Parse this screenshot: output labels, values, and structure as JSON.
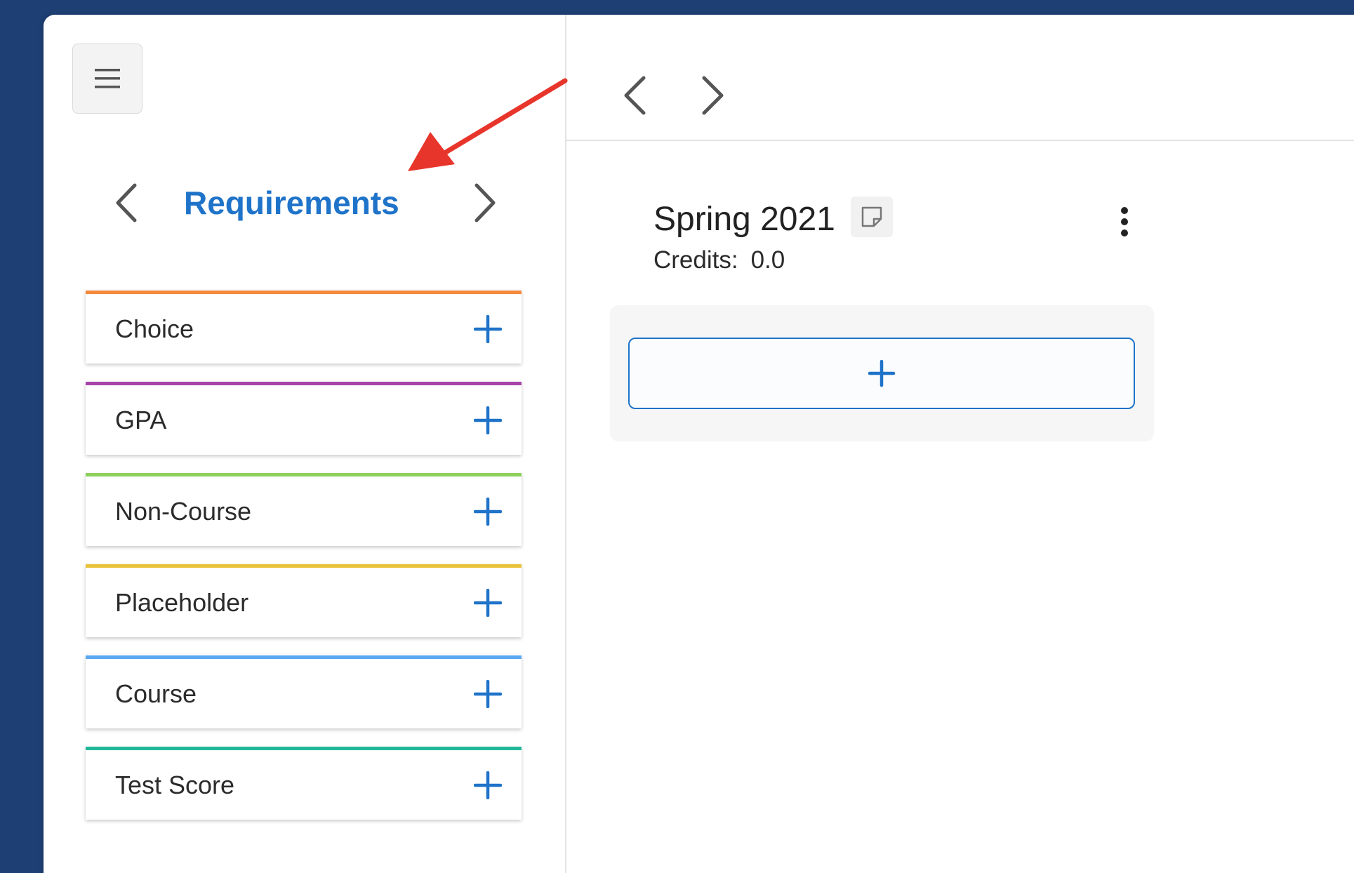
{
  "sidebar": {
    "menu_icon": "hamburger-icon",
    "title": "Requirements",
    "prev_icon": "chevron-left-icon",
    "next_icon": "chevron-right-icon",
    "requirements": [
      {
        "label": "Choice",
        "color": "#f58a3c"
      },
      {
        "label": "GPA",
        "color": "#a745a8"
      },
      {
        "label": "Non-Course",
        "color": "#8ccf5a"
      },
      {
        "label": "Placeholder",
        "color": "#e8c33a"
      },
      {
        "label": "Course",
        "color": "#5aa9f2"
      },
      {
        "label": "Test Score",
        "color": "#1fb898"
      }
    ],
    "add_icon": "plus-icon"
  },
  "term": {
    "title": "Spring 2021",
    "credits_label": "Credits:",
    "credits_value": "0.0",
    "note_icon": "sticky-note-icon",
    "menu_icon": "more-vertical-icon",
    "add_icon": "plus-icon"
  },
  "colors": {
    "accent": "#1f73c9",
    "background": "#1d3f73",
    "annotation_arrow": "#e8352b"
  }
}
